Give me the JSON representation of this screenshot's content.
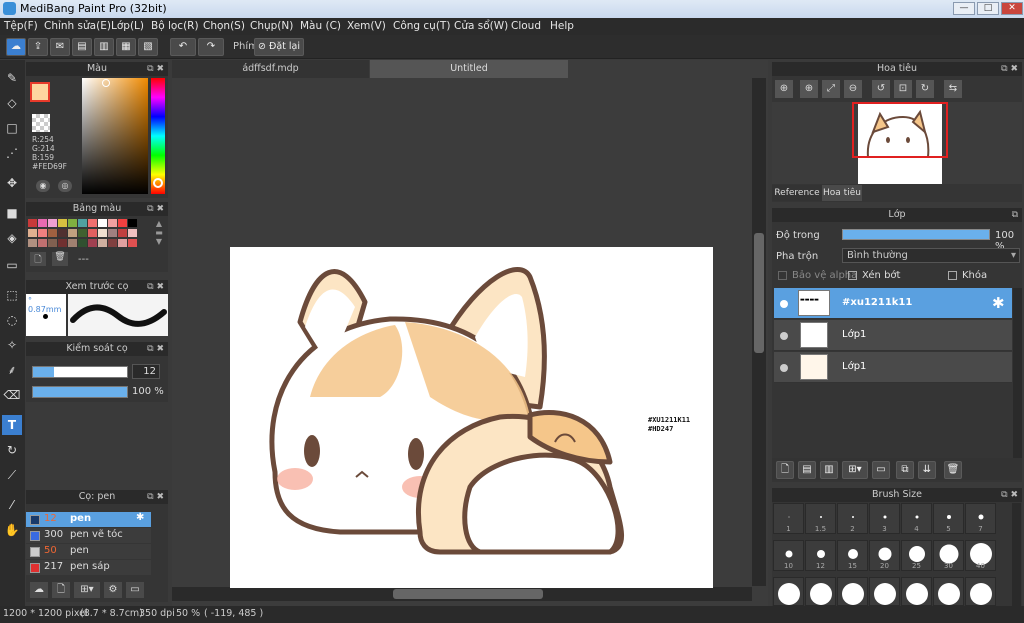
{
  "window": {
    "title": "MediBang Paint Pro (32bit)",
    "minimize": "—",
    "maximize": "□",
    "close": "✕"
  },
  "menu": [
    "Tệp(F)",
    "Chỉnh sửa(E)",
    "Lớp(L)",
    "Bộ lọc(R)",
    "Chọn(S)",
    "Chụp(N)",
    "Màu (C)",
    "Xem(V)",
    "Công cụ(T)",
    "Cửa sổ(W)",
    "Cloud",
    "Help"
  ],
  "toolbar": {
    "shortcut_label": "Phím",
    "reset_label": "Đặt lại"
  },
  "color_panel": {
    "title": "Màu",
    "r": "R:254",
    "g": "G:214",
    "b": "B:159",
    "hex": "#FED69F",
    "fg": "#fed69f",
    "accent_red": "#e83a2a"
  },
  "palette_panel": {
    "title": "Bảng màu",
    "value": "---"
  },
  "brush_preview_panel": {
    "title": "Xem trước cọ",
    "size": "0.87mm"
  },
  "brush_control_panel": {
    "title": "Kiểm soát cọ",
    "size_value": "12",
    "opacity_value": "100 %"
  },
  "brush_list_panel": {
    "title": "Cọ: pen",
    "items": [
      {
        "size": "12",
        "name": "pen",
        "color": "#1a3a6a",
        "selected": true
      },
      {
        "size": "300",
        "name": "pen vẽ tóc",
        "color": "#3a6ae0",
        "selected": false
      },
      {
        "size": "50",
        "name": "pen",
        "color": "#cccccc",
        "selected": false
      },
      {
        "size": "217",
        "name": "pen sáp",
        "color": "#e03030",
        "selected": false
      }
    ]
  },
  "canvas": {
    "tabs": [
      "ádffsdf.mdp",
      "Untitled"
    ],
    "watermark_line1": "#XU1211K11",
    "watermark_line2": "#HD247"
  },
  "navigator_panel": {
    "title": "Hoa tiêu",
    "tab_reference": "Reference",
    "tab_navigator": "Hoa tiêu"
  },
  "layer_panel": {
    "title": "Lớp",
    "opacity_label": "Độ trong",
    "opacity_value": "100 %",
    "opacity": 1.0,
    "blend_label": "Pha trộn",
    "blend_value": "Bình thường",
    "protect_alpha": "Bảo vệ alpha",
    "clipping": "Xén bớt",
    "lock": "Khóa",
    "layers": [
      {
        "name": "#xu1211k11",
        "selected": true
      },
      {
        "name": "Lớp1",
        "selected": false
      },
      {
        "name": "Lớp1",
        "selected": false
      }
    ]
  },
  "brush_size_panel": {
    "title": "Brush Size",
    "row1": [
      "1",
      "1.5",
      "2",
      "3",
      "4",
      "5",
      "7"
    ],
    "row2": [
      "10",
      "12",
      "15",
      "20",
      "25",
      "30",
      "40"
    ]
  },
  "status": {
    "size": "1200 * 1200 pixel",
    "cm": "(8.7 * 8.7cm)",
    "dpi": "350 dpi",
    "zoom": "50 %",
    "coords": "( -119, 485 )"
  }
}
